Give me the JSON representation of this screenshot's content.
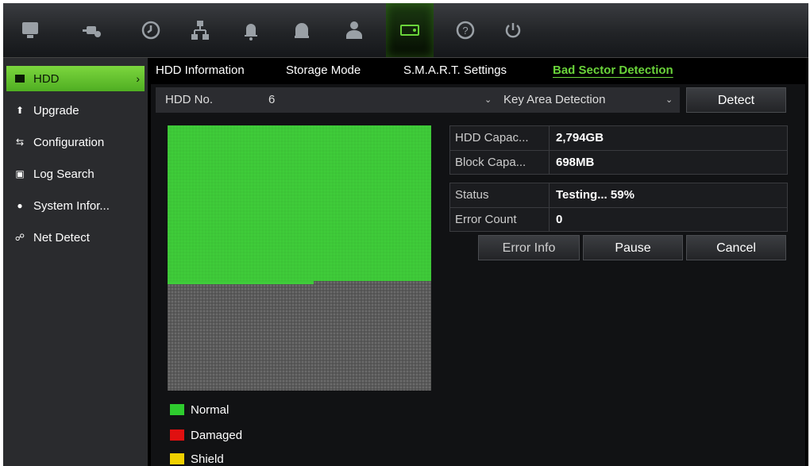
{
  "toolbar": {
    "icons": [
      {
        "name": "live-view-icon",
        "active": false
      },
      {
        "name": "camera-settings-icon",
        "active": false
      },
      {
        "name": "playback-clock-icon",
        "active": false
      },
      {
        "name": "network-icon",
        "active": false
      },
      {
        "name": "alarm-bell-icon",
        "active": false
      },
      {
        "name": "device-icon",
        "active": false
      },
      {
        "name": "user-icon",
        "active": false
      },
      {
        "name": "storage-hdd-icon",
        "active": true
      },
      {
        "name": "help-icon",
        "active": false
      },
      {
        "name": "power-icon",
        "active": false
      }
    ]
  },
  "sidebar": {
    "items": [
      {
        "label": "HDD",
        "icon": "hdd-icon",
        "active": true
      },
      {
        "label": "Upgrade",
        "icon": "upgrade-icon",
        "active": false
      },
      {
        "label": "Configuration",
        "icon": "configuration-icon",
        "active": false
      },
      {
        "label": "Log Search",
        "icon": "log-search-icon",
        "active": false
      },
      {
        "label": "System Infor...",
        "icon": "info-icon",
        "active": false
      },
      {
        "label": "Net Detect",
        "icon": "net-detect-icon",
        "active": false
      }
    ]
  },
  "tabs": [
    {
      "label": "HDD Information",
      "active": false
    },
    {
      "label": "Storage Mode",
      "active": false
    },
    {
      "label": "S.M.A.R.T. Settings",
      "active": false
    },
    {
      "label": "Bad Sector Detection",
      "active": true
    }
  ],
  "form": {
    "hdd_no_label": "HDD No.",
    "hdd_no_value": "6",
    "detection_type": "Key Area Detection",
    "detect_label": "Detect"
  },
  "info": {
    "hdd_capacity_label": "HDD Capac...",
    "hdd_capacity_value": "2,794GB",
    "block_capacity_label": "Block Capa...",
    "block_capacity_value": "698MB",
    "status_label": "Status",
    "status_value": "Testing... 59%",
    "error_count_label": "Error Count",
    "error_count_value": "0"
  },
  "actions": {
    "error_info_label": "Error Info",
    "pause_label": "Pause",
    "cancel_label": "Cancel"
  },
  "progress_fraction": 0.59,
  "legend": [
    {
      "label": "Normal",
      "color": "#2ecc2e"
    },
    {
      "label": "Damaged",
      "color": "#e01010"
    },
    {
      "label": "Shield",
      "color": "#f0d000"
    }
  ],
  "colors": {
    "accent": "#6ad43a",
    "normal_block": "#3fcc3a",
    "untested_block": "#6b6b6b"
  }
}
